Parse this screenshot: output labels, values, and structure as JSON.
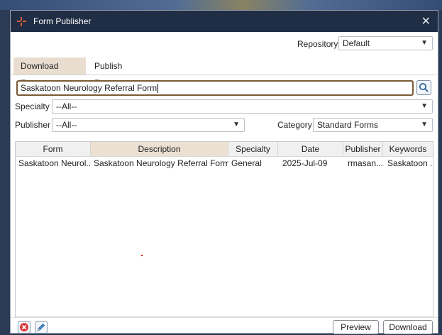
{
  "window": {
    "title": "Form Publisher"
  },
  "repository": {
    "label": "Repository",
    "value": "Default"
  },
  "tabs": [
    {
      "label": "Download Forms"
    },
    {
      "label": "Publish Forms"
    }
  ],
  "search": {
    "value": "Saskatoon Neurology Referral Form"
  },
  "specialty": {
    "label": "Specialty",
    "value": "--All--"
  },
  "publisher": {
    "label": "Publisher",
    "value": "--All--"
  },
  "category": {
    "label": "Category",
    "value": "Standard Forms"
  },
  "table": {
    "columns": [
      "Form",
      "Description",
      "Specialty",
      "Date",
      "Publisher",
      "Keywords"
    ],
    "rows": [
      [
        "Saskatoon Neurol...",
        "Saskatoon Neurology Referral Form",
        "General",
        "2025-Jul-09",
        "rmasan...",
        "Saskatoon ..."
      ]
    ]
  },
  "buttons": {
    "preview": "Preview",
    "download": "Download"
  },
  "colors": {
    "titlebar": "#1f2e44",
    "active_tab": "#e9ddcf",
    "accent": "#7a5a35",
    "delete_icon": "#d8383a"
  }
}
